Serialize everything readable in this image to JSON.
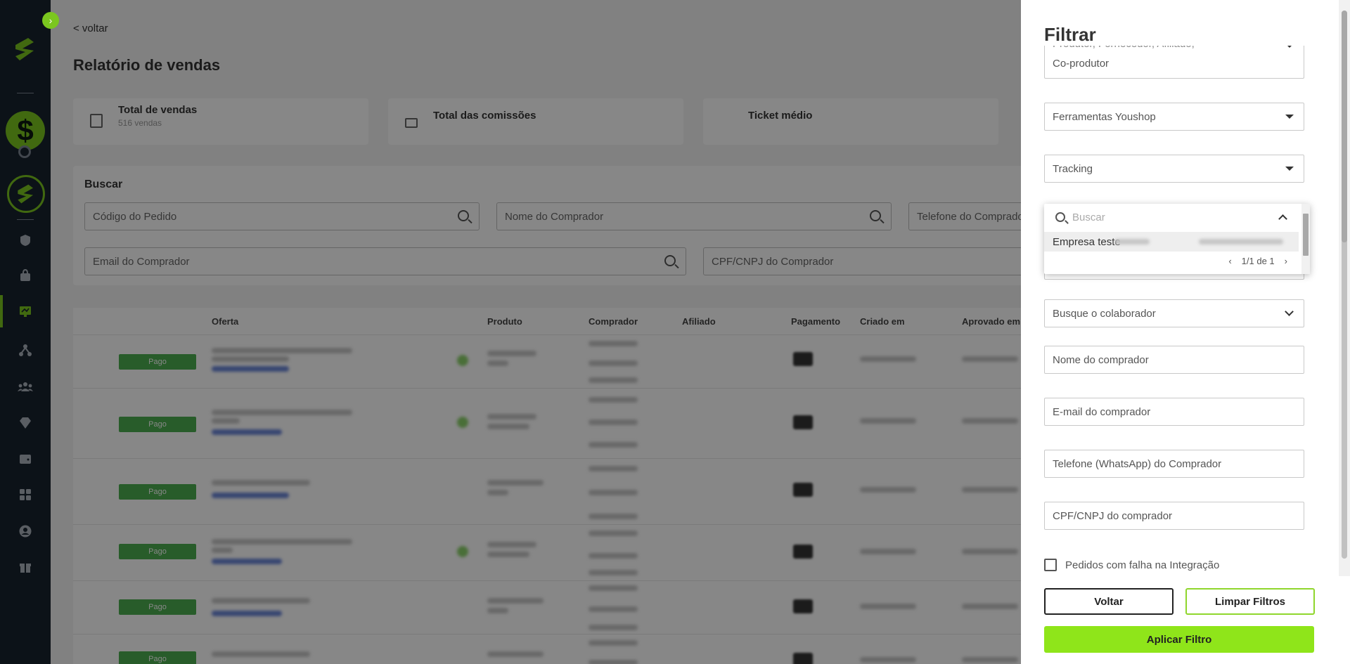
{
  "sidebar": {
    "toggle_glyph": "›",
    "coin_glyph": "$",
    "icons": [
      "shield-icon",
      "bag-icon",
      "sales-icon",
      "network-icon",
      "users-icon",
      "diamond-icon",
      "wallet-icon",
      "apps-icon",
      "profile-icon",
      "gift-icon"
    ]
  },
  "main": {
    "back": "< voltar",
    "title": "Relatório de vendas",
    "cards": [
      {
        "label": "Total de vendas",
        "sub": "516 vendas"
      },
      {
        "label": "Total das comissões",
        "sub": ""
      },
      {
        "label": "Ticket médio",
        "sub": ""
      }
    ],
    "search": {
      "title": "Buscar",
      "order_code": "Código do Pedido",
      "buyer_name": "Nome do Comprador",
      "buyer_phone": "Telefone do Comprador",
      "buyer_email": "Email do Comprador",
      "buyer_doc": "CPF/CNPJ do Comprador"
    },
    "table": {
      "columns": {
        "offer": "Oferta",
        "product": "Produto",
        "buyer": "Comprador",
        "affiliate": "Afiliado",
        "payment": "Pagamento",
        "created": "Criado em",
        "approved": "Aprovado em"
      },
      "status_label": "Pago"
    }
  },
  "drawer": {
    "title": "Filtrar",
    "roles_line1": "Produtor, Fornecedor, Afiliado,",
    "roles_line2": "Co-produtor",
    "tools": "Ferramentas Youshop",
    "tracking": "Tracking",
    "dropdown": {
      "search_placeholder": "Buscar",
      "item": "Empresa teste",
      "pagination": "1/1 de 1"
    },
    "collaborator": "Busque o colaborador",
    "buyer_name": "Nome do comprador",
    "buyer_email": "E-mail do comprador",
    "buyer_phone": "Telefone (WhatsApp) do Comprador",
    "buyer_doc": "CPF/CNPJ do comprador",
    "integration_fail": "Pedidos com falha na Integração",
    "back_button": "Voltar",
    "clear_button": "Limpar Filtros",
    "apply_button": "Aplicar Filtro"
  },
  "colors": {
    "accent": "#8fe51a",
    "sidebar_bg": "#18222e",
    "paid": "#4caf50"
  }
}
